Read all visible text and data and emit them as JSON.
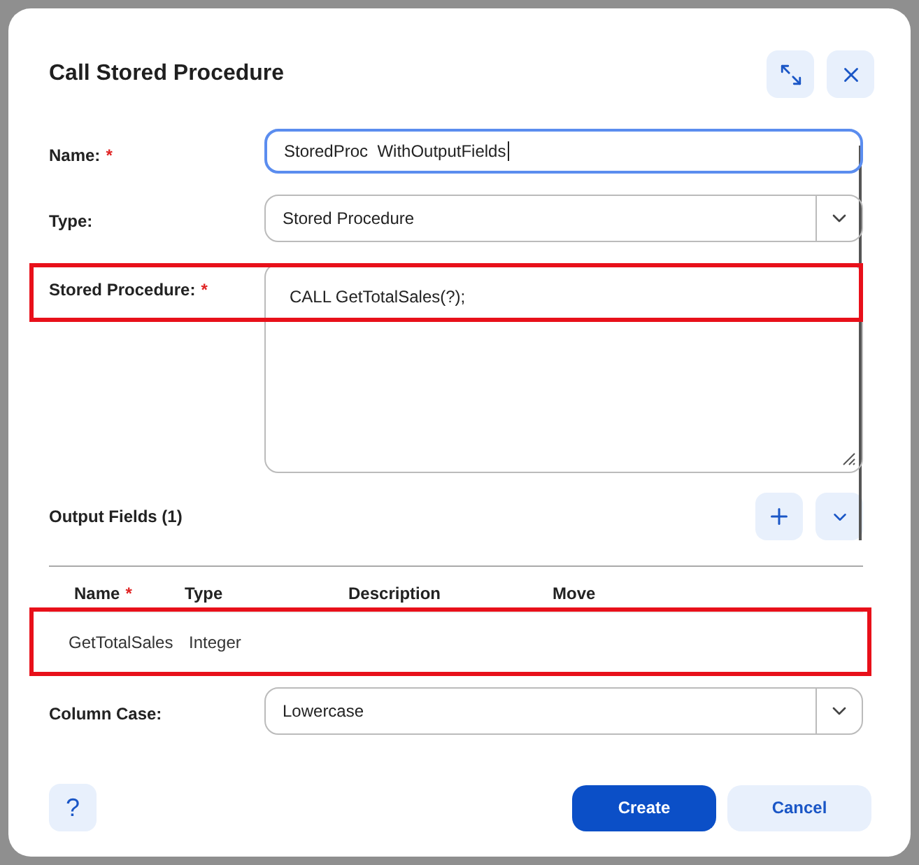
{
  "dialog": {
    "title": "Call Stored Procedure"
  },
  "fields": [
    {
      "kind": "input",
      "label": "Name:",
      "mark": "*",
      "value": "StoredProc  WithOutputFields",
      "focused": true
    },
    {
      "kind": "select",
      "label": "Type:",
      "value": "Stored Procedure"
    },
    {
      "kind": "textarea",
      "label": "Stored Procedure:",
      "mark": "*",
      "value": "CALL GetTotalSales(?);",
      "highlighted": true
    }
  ],
  "output_fields": {
    "title": "Output Fields (1)",
    "columns": [
      {
        "label": "Name",
        "mark": "*"
      },
      {
        "label": "Type"
      },
      {
        "label": "Description"
      },
      {
        "label": "Move"
      }
    ],
    "rows": [
      {
        "cells": [
          "GetTotalSales",
          "Integer"
        ],
        "highlighted": true
      }
    ]
  },
  "column_case": {
    "label": "Column Case:",
    "value": "Lowercase"
  },
  "buttons": [
    {
      "kind": "primary",
      "label": "Create"
    },
    {
      "kind": "secondary",
      "label": "Cancel"
    }
  ],
  "help": "?"
}
